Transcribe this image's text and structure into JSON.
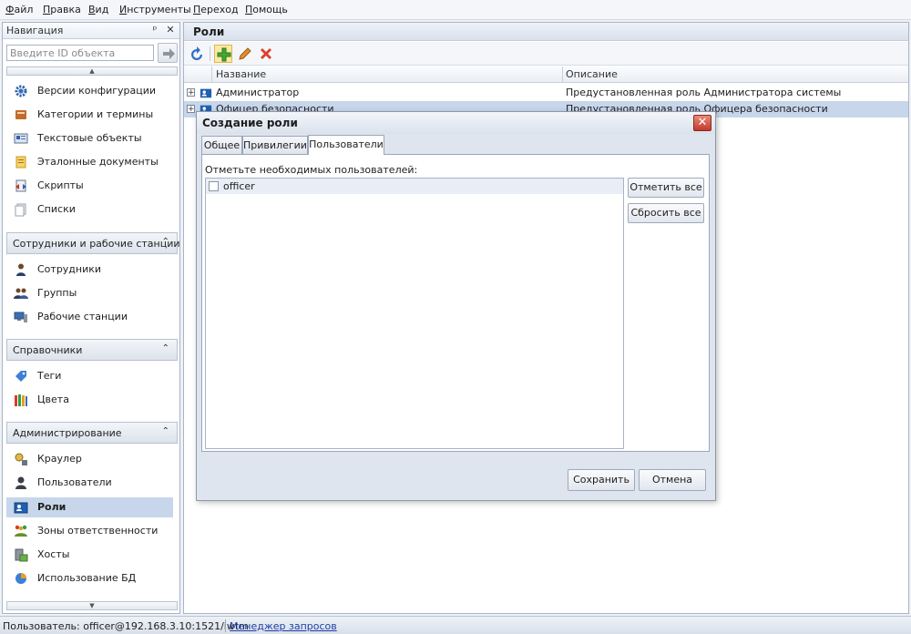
{
  "menu": [
    {
      "first": "Ф",
      "rest": "айл"
    },
    {
      "first": "П",
      "rest": "равка"
    },
    {
      "first": "В",
      "rest": "ид"
    },
    {
      "first": "И",
      "rest": "нструменты"
    },
    {
      "first": "П",
      "rest": "ереход"
    },
    {
      "first": "П",
      "rest": "омощь"
    }
  ],
  "nav": {
    "title": "Навигация",
    "pin_glyph": "ᵖ",
    "close_glyph": "✕",
    "search_placeholder": "Введите ID объекта",
    "scroll_up": "▲",
    "scroll_down": "▼",
    "items_top": [
      {
        "label": "Версии конфигурации",
        "icon": "gear-icon"
      },
      {
        "label": "Категории и термины",
        "icon": "book-icon"
      },
      {
        "label": "Текстовые объекты",
        "icon": "text-object-icon"
      },
      {
        "label": "Эталонные документы",
        "icon": "document-icon"
      },
      {
        "label": "Скрипты",
        "icon": "script-icon"
      },
      {
        "label": "Списки",
        "icon": "list-icon"
      }
    ],
    "groups": [
      {
        "title": "Сотрудники и рабочие станции",
        "chevron": "⌃",
        "items": [
          {
            "label": "Сотрудники",
            "icon": "employee-icon"
          },
          {
            "label": "Группы",
            "icon": "group-icon"
          },
          {
            "label": "Рабочие станции",
            "icon": "workstation-icon"
          }
        ]
      },
      {
        "title": "Справочники",
        "chevron": "⌃",
        "items": [
          {
            "label": "Теги",
            "icon": "tag-icon"
          },
          {
            "label": "Цвета",
            "icon": "colors-icon"
          }
        ]
      },
      {
        "title": "Администрирование",
        "chevron": "⌃",
        "items": [
          {
            "label": "Краулер",
            "icon": "crawler-icon"
          },
          {
            "label": "Пользователи",
            "icon": "user-icon"
          },
          {
            "label": "Роли",
            "icon": "role-icon",
            "selected": true
          },
          {
            "label": "Зоны ответственности",
            "icon": "zones-icon"
          },
          {
            "label": "Хосты",
            "icon": "hosts-icon"
          },
          {
            "label": "Использование БД",
            "icon": "database-icon"
          }
        ]
      }
    ]
  },
  "roles": {
    "title": "Роли",
    "columns": [
      "Название",
      "Описание"
    ],
    "rows": [
      {
        "expander": "+",
        "name": "Администратор",
        "description": "Предустановленная роль Администратора системы"
      },
      {
        "expander": "+",
        "name": "Офицер безопасности",
        "description": "Предустановленная роль Офицера безопасности"
      }
    ]
  },
  "dialog": {
    "title": "Создание роли",
    "close_glyph": "✕",
    "tabs": [
      "Общее",
      "Привилегии",
      "Пользователи"
    ],
    "active_tab": 2,
    "users_label": "Отметьте необходимых пользователей:",
    "users": [
      {
        "name": "officer",
        "checked": false
      }
    ],
    "check_all": "Отметить все",
    "reset_all": "Сбросить все",
    "save": "Сохранить",
    "cancel": "Отмена"
  },
  "status": {
    "user": "Пользователь: officer@192.168.3.10:1521/iwtm",
    "link": "Менеджер запросов"
  },
  "colors": {
    "selection": "#c7d6ea",
    "link": "#1c3fa8",
    "close_button": "#c2392a"
  }
}
